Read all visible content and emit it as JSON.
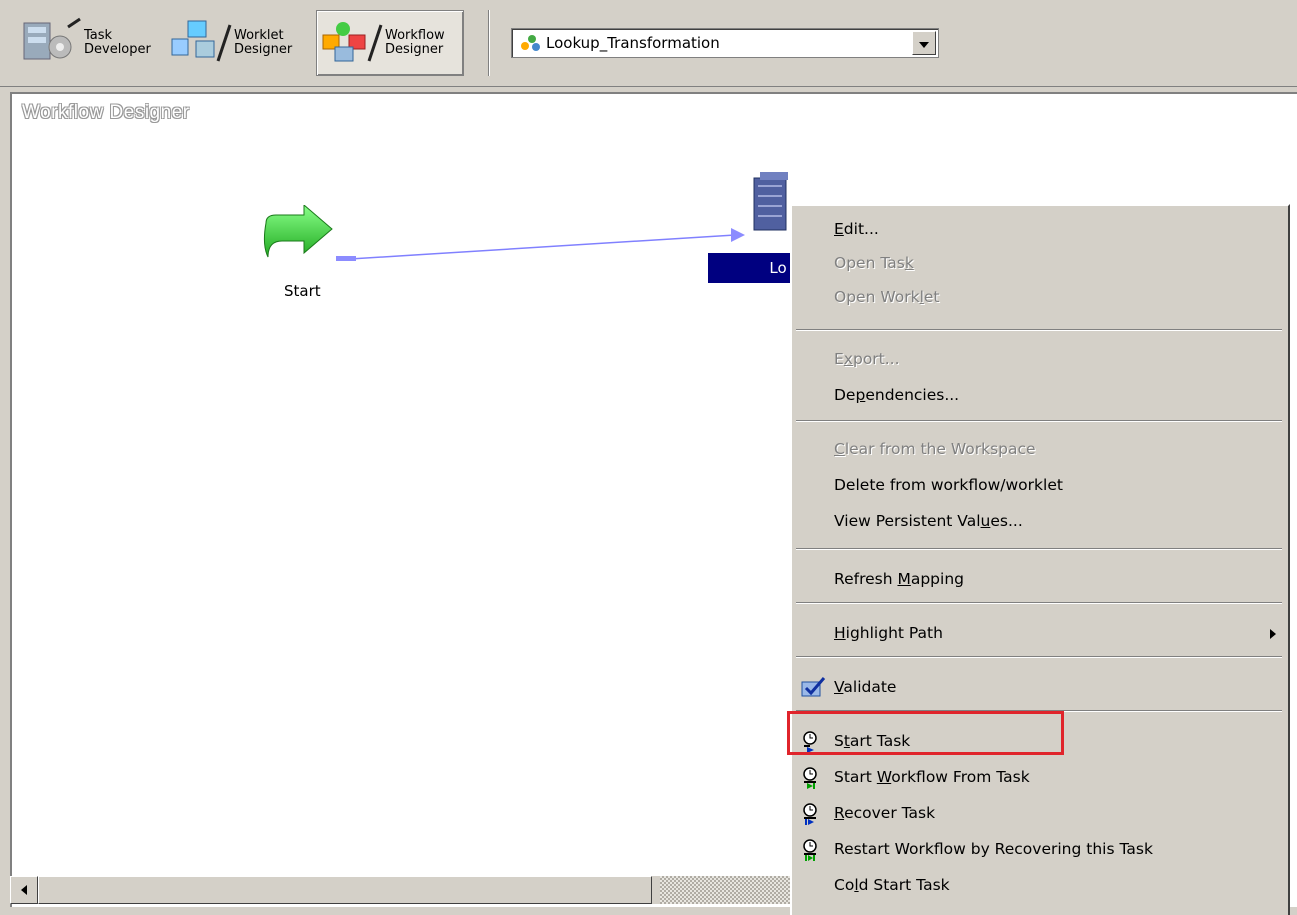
{
  "toolbar": {
    "buttons": [
      {
        "label": "Task\nDeveloper",
        "icon": "task-developer-icon"
      },
      {
        "label": "Worklet\nDesigner",
        "icon": "worklet-designer-icon"
      },
      {
        "label": "Workflow\nDesigner",
        "icon": "workflow-designer-icon",
        "active": true
      }
    ],
    "workflow_select": {
      "value": "Lookup_Transformation",
      "icon": "workflow-icon"
    }
  },
  "workspace": {
    "title": "Workflow Designer",
    "start_node": {
      "label": "Start",
      "icon": "start-arrow-icon"
    },
    "task_node": {
      "label": "Lo",
      "icon": "session-task-icon"
    }
  },
  "context_menu": {
    "items": [
      {
        "label": "Edit...",
        "underline": "E",
        "enabled": true
      },
      {
        "label": "Open Task",
        "underline": "k",
        "enabled": false
      },
      {
        "label": "Open Worklet",
        "underline": "l",
        "enabled": false
      },
      {
        "separator": true
      },
      {
        "label": "Export...",
        "underline": "x",
        "enabled": false
      },
      {
        "label": "Dependencies...",
        "underline": "p",
        "enabled": true
      },
      {
        "separator": true
      },
      {
        "label": "Clear from the Workspace",
        "underline": "C",
        "enabled": false
      },
      {
        "label": "Delete from workflow/worklet",
        "enabled": true
      },
      {
        "label": "View Persistent Values...",
        "underline": "u",
        "enabled": true
      },
      {
        "separator": true
      },
      {
        "label": "Refresh Mapping",
        "underline": "M",
        "enabled": true
      },
      {
        "separator": true
      },
      {
        "label": "Highlight Path",
        "underline": "H",
        "enabled": true,
        "submenu": true
      },
      {
        "separator": true
      },
      {
        "label": "Validate",
        "underline": "V",
        "enabled": true,
        "icon": "validate-icon"
      },
      {
        "separator": true
      },
      {
        "label": "Start Task",
        "underline": "t",
        "enabled": true,
        "icon": "start-task-icon",
        "highlighted": true
      },
      {
        "label": "Start Workflow From Task",
        "underline": "W",
        "enabled": true,
        "icon": "start-workflow-from-task-icon"
      },
      {
        "label": "Recover Task",
        "underline": "R",
        "enabled": true,
        "icon": "recover-task-icon"
      },
      {
        "label": "Restart Workflow by Recovering this Task",
        "enabled": true,
        "icon": "restart-workflow-icon"
      },
      {
        "label": "Cold Start Task",
        "underline": "l",
        "enabled": true
      }
    ]
  },
  "colors": {
    "highlight_box": "#e0242b",
    "selection": "#000080",
    "link_line": "#8080ff"
  }
}
